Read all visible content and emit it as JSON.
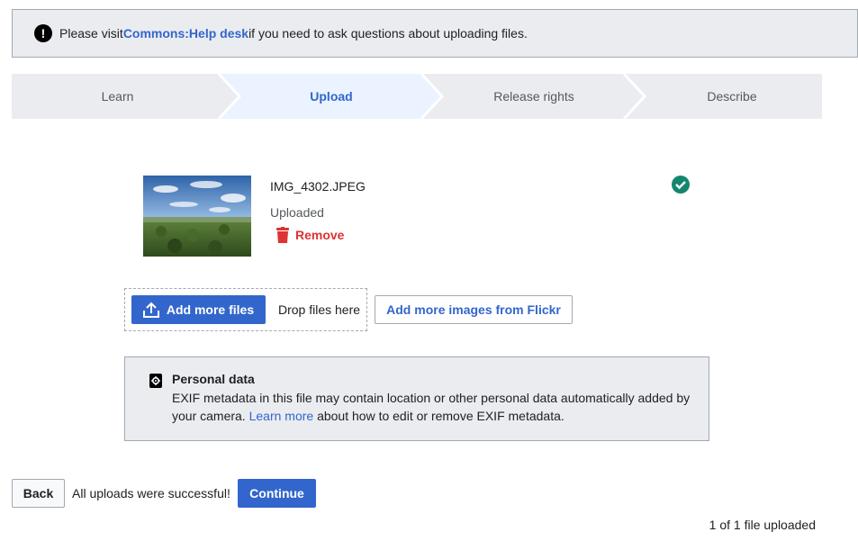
{
  "notice": {
    "prefix": "Please visit ",
    "link": "Commons:Help desk",
    "suffix": " if you need to ask questions about uploading files."
  },
  "steps": [
    {
      "label": "Learn",
      "active": false
    },
    {
      "label": "Upload",
      "active": true
    },
    {
      "label": "Release rights",
      "active": false
    },
    {
      "label": "Describe",
      "active": false
    }
  ],
  "file": {
    "name": "IMG_4302.JPEG",
    "status": "Uploaded",
    "remove_label": "Remove"
  },
  "upload_actions": {
    "add_more_label": "Add more files",
    "drop_text": "Drop files here",
    "flickr_label": "Add more images from Flickr"
  },
  "personal_data": {
    "title": "Personal data",
    "text_before": "EXIF metadata in this file may contain location or other personal data automatically added by your camera. ",
    "link": "Learn more",
    "text_after": " about how to edit or remove EXIF metadata."
  },
  "footer": {
    "back_label": "Back",
    "success_text": "All uploads were successful!",
    "continue_label": "Continue",
    "count_text": "1 of 1 file uploaded"
  },
  "colors": {
    "accent": "#3366cc",
    "step_active_bg": "#eaf3ff",
    "step_bg": "#eaecf0",
    "success": "#14866d",
    "destructive": "#d33333"
  }
}
